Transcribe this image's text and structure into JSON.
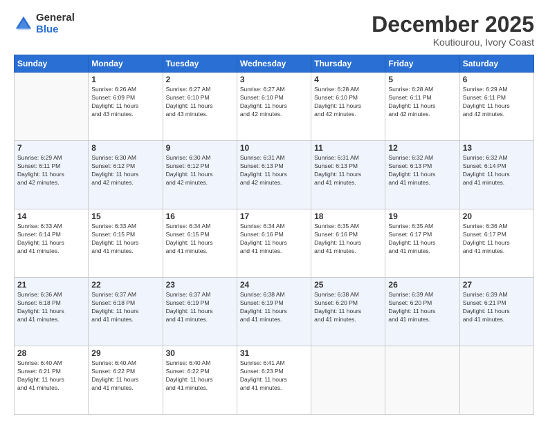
{
  "header": {
    "logo_general": "General",
    "logo_blue": "Blue",
    "month": "December 2025",
    "location": "Koutiourou, Ivory Coast"
  },
  "weekdays": [
    "Sunday",
    "Monday",
    "Tuesday",
    "Wednesday",
    "Thursday",
    "Friday",
    "Saturday"
  ],
  "weeks": [
    [
      {
        "day": "",
        "info": ""
      },
      {
        "day": "1",
        "info": "Sunrise: 6:26 AM\nSunset: 6:09 PM\nDaylight: 11 hours\nand 43 minutes."
      },
      {
        "day": "2",
        "info": "Sunrise: 6:27 AM\nSunset: 6:10 PM\nDaylight: 11 hours\nand 43 minutes."
      },
      {
        "day": "3",
        "info": "Sunrise: 6:27 AM\nSunset: 6:10 PM\nDaylight: 11 hours\nand 42 minutes."
      },
      {
        "day": "4",
        "info": "Sunrise: 6:28 AM\nSunset: 6:10 PM\nDaylight: 11 hours\nand 42 minutes."
      },
      {
        "day": "5",
        "info": "Sunrise: 6:28 AM\nSunset: 6:11 PM\nDaylight: 11 hours\nand 42 minutes."
      },
      {
        "day": "6",
        "info": "Sunrise: 6:29 AM\nSunset: 6:11 PM\nDaylight: 11 hours\nand 42 minutes."
      }
    ],
    [
      {
        "day": "7",
        "info": "Sunrise: 6:29 AM\nSunset: 6:11 PM\nDaylight: 11 hours\nand 42 minutes."
      },
      {
        "day": "8",
        "info": "Sunrise: 6:30 AM\nSunset: 6:12 PM\nDaylight: 11 hours\nand 42 minutes."
      },
      {
        "day": "9",
        "info": "Sunrise: 6:30 AM\nSunset: 6:12 PM\nDaylight: 11 hours\nand 42 minutes."
      },
      {
        "day": "10",
        "info": "Sunrise: 6:31 AM\nSunset: 6:13 PM\nDaylight: 11 hours\nand 42 minutes."
      },
      {
        "day": "11",
        "info": "Sunrise: 6:31 AM\nSunset: 6:13 PM\nDaylight: 11 hours\nand 41 minutes."
      },
      {
        "day": "12",
        "info": "Sunrise: 6:32 AM\nSunset: 6:13 PM\nDaylight: 11 hours\nand 41 minutes."
      },
      {
        "day": "13",
        "info": "Sunrise: 6:32 AM\nSunset: 6:14 PM\nDaylight: 11 hours\nand 41 minutes."
      }
    ],
    [
      {
        "day": "14",
        "info": "Sunrise: 6:33 AM\nSunset: 6:14 PM\nDaylight: 11 hours\nand 41 minutes."
      },
      {
        "day": "15",
        "info": "Sunrise: 6:33 AM\nSunset: 6:15 PM\nDaylight: 11 hours\nand 41 minutes."
      },
      {
        "day": "16",
        "info": "Sunrise: 6:34 AM\nSunset: 6:15 PM\nDaylight: 11 hours\nand 41 minutes."
      },
      {
        "day": "17",
        "info": "Sunrise: 6:34 AM\nSunset: 6:16 PM\nDaylight: 11 hours\nand 41 minutes."
      },
      {
        "day": "18",
        "info": "Sunrise: 6:35 AM\nSunset: 6:16 PM\nDaylight: 11 hours\nand 41 minutes."
      },
      {
        "day": "19",
        "info": "Sunrise: 6:35 AM\nSunset: 6:17 PM\nDaylight: 11 hours\nand 41 minutes."
      },
      {
        "day": "20",
        "info": "Sunrise: 6:36 AM\nSunset: 6:17 PM\nDaylight: 11 hours\nand 41 minutes."
      }
    ],
    [
      {
        "day": "21",
        "info": "Sunrise: 6:36 AM\nSunset: 6:18 PM\nDaylight: 11 hours\nand 41 minutes."
      },
      {
        "day": "22",
        "info": "Sunrise: 6:37 AM\nSunset: 6:18 PM\nDaylight: 11 hours\nand 41 minutes."
      },
      {
        "day": "23",
        "info": "Sunrise: 6:37 AM\nSunset: 6:19 PM\nDaylight: 11 hours\nand 41 minutes."
      },
      {
        "day": "24",
        "info": "Sunrise: 6:38 AM\nSunset: 6:19 PM\nDaylight: 11 hours\nand 41 minutes."
      },
      {
        "day": "25",
        "info": "Sunrise: 6:38 AM\nSunset: 6:20 PM\nDaylight: 11 hours\nand 41 minutes."
      },
      {
        "day": "26",
        "info": "Sunrise: 6:39 AM\nSunset: 6:20 PM\nDaylight: 11 hours\nand 41 minutes."
      },
      {
        "day": "27",
        "info": "Sunrise: 6:39 AM\nSunset: 6:21 PM\nDaylight: 11 hours\nand 41 minutes."
      }
    ],
    [
      {
        "day": "28",
        "info": "Sunrise: 6:40 AM\nSunset: 6:21 PM\nDaylight: 11 hours\nand 41 minutes."
      },
      {
        "day": "29",
        "info": "Sunrise: 6:40 AM\nSunset: 6:22 PM\nDaylight: 11 hours\nand 41 minutes."
      },
      {
        "day": "30",
        "info": "Sunrise: 6:40 AM\nSunset: 6:22 PM\nDaylight: 11 hours\nand 41 minutes."
      },
      {
        "day": "31",
        "info": "Sunrise: 6:41 AM\nSunset: 6:23 PM\nDaylight: 11 hours\nand 41 minutes."
      },
      {
        "day": "",
        "info": ""
      },
      {
        "day": "",
        "info": ""
      },
      {
        "day": "",
        "info": ""
      }
    ]
  ]
}
